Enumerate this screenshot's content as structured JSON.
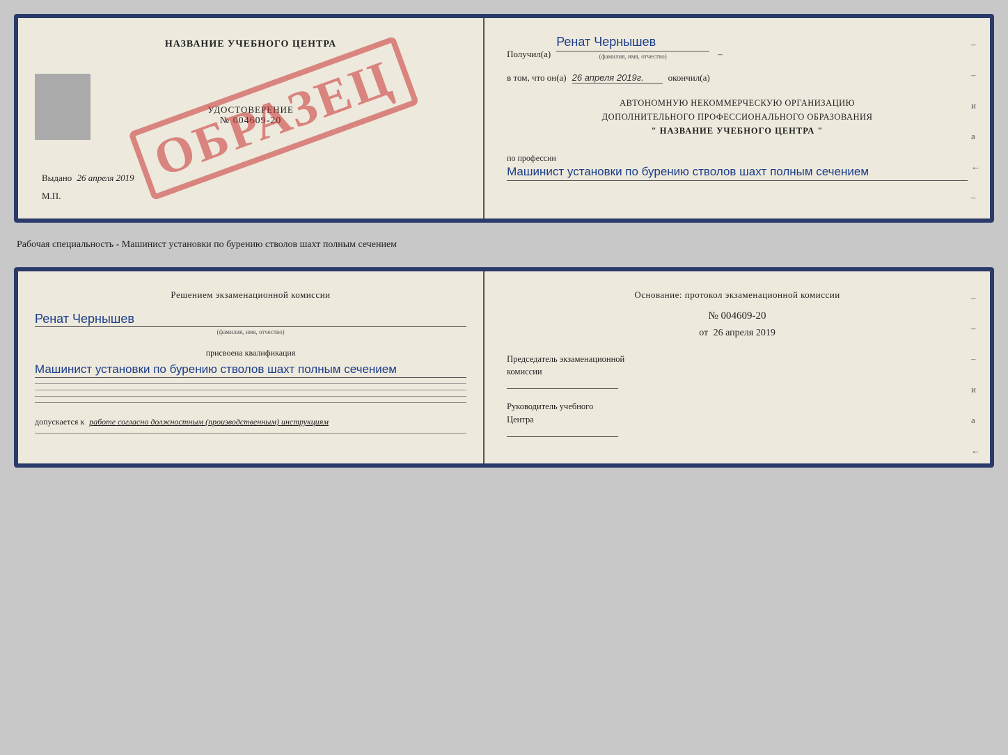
{
  "top_doc": {
    "left": {
      "training_center": "НАЗВАНИЕ УЧЕБНОГО ЦЕНТРА",
      "udostoverenie_label": "УДОСТОВЕРЕНИЕ",
      "nomer": "№ 004609-20",
      "vydano_label": "Выдано",
      "vydano_date": "26 апреля 2019",
      "mp": "М.П.",
      "stamp": "ОБРАЗЕЦ"
    },
    "right": {
      "poluchil_label": "Получил(а)",
      "poluchil_name": "Ренат Чернышев",
      "fio_hint": "(фамилия, имя, отчество)",
      "dash": "–",
      "vtom_label": "в том, что он(а)",
      "vtom_date": "26 апреля 2019г.",
      "okonchil_label": "окончил(а)",
      "org_line1": "АВТОНОМНУЮ НЕКОММЕРЧЕСКУЮ ОРГАНИЗАЦИЮ",
      "org_line2": "ДОПОЛНИТЕЛЬНОГО ПРОФЕССИОНАЛЬНОГО ОБРАЗОВАНИЯ",
      "org_name": "\"  НАЗВАНИЕ УЧЕБНОГО ЦЕНТРА  \"",
      "po_professii_label": "по профессии",
      "professiya": "Машинист установки по бурению стволов шахт полным сечением",
      "dashes": [
        "–",
        "–",
        "и",
        "а",
        "←",
        "–",
        "–"
      ]
    }
  },
  "middle": {
    "text": "Рабочая специальность - Машинист установки по бурению стволов шахт полным сечением"
  },
  "bottom_doc": {
    "left": {
      "resheniem_label": "Решением  экзаменационной  комиссии",
      "fio": "Ренат Чернышев",
      "fio_hint": "(фамилия, имя, отчество)",
      "prisvoena_label": "присвоена квалификация",
      "kvalifikaciya": "Машинист установки по бурению стволов шахт полным сечением",
      "dopuskaetsya_prefix": "допускается к",
      "dopuskaetsya_italic": "работе согласно должностным (производственным) инструкциям"
    },
    "right": {
      "osnovanie_label": "Основание: протокол экзаменационной  комиссии",
      "protocol_number": "№  004609-20",
      "protocol_date_prefix": "от",
      "protocol_date": "26 апреля 2019",
      "predsedatel_line1": "Председатель экзаменационной",
      "predsedatel_line2": "комиссии",
      "rukovoditel_line1": "Руководитель учебного",
      "rukovoditel_line2": "Центра",
      "dashes": [
        "–",
        "–",
        "–",
        "и",
        "а",
        "←",
        "–",
        "–"
      ]
    }
  }
}
